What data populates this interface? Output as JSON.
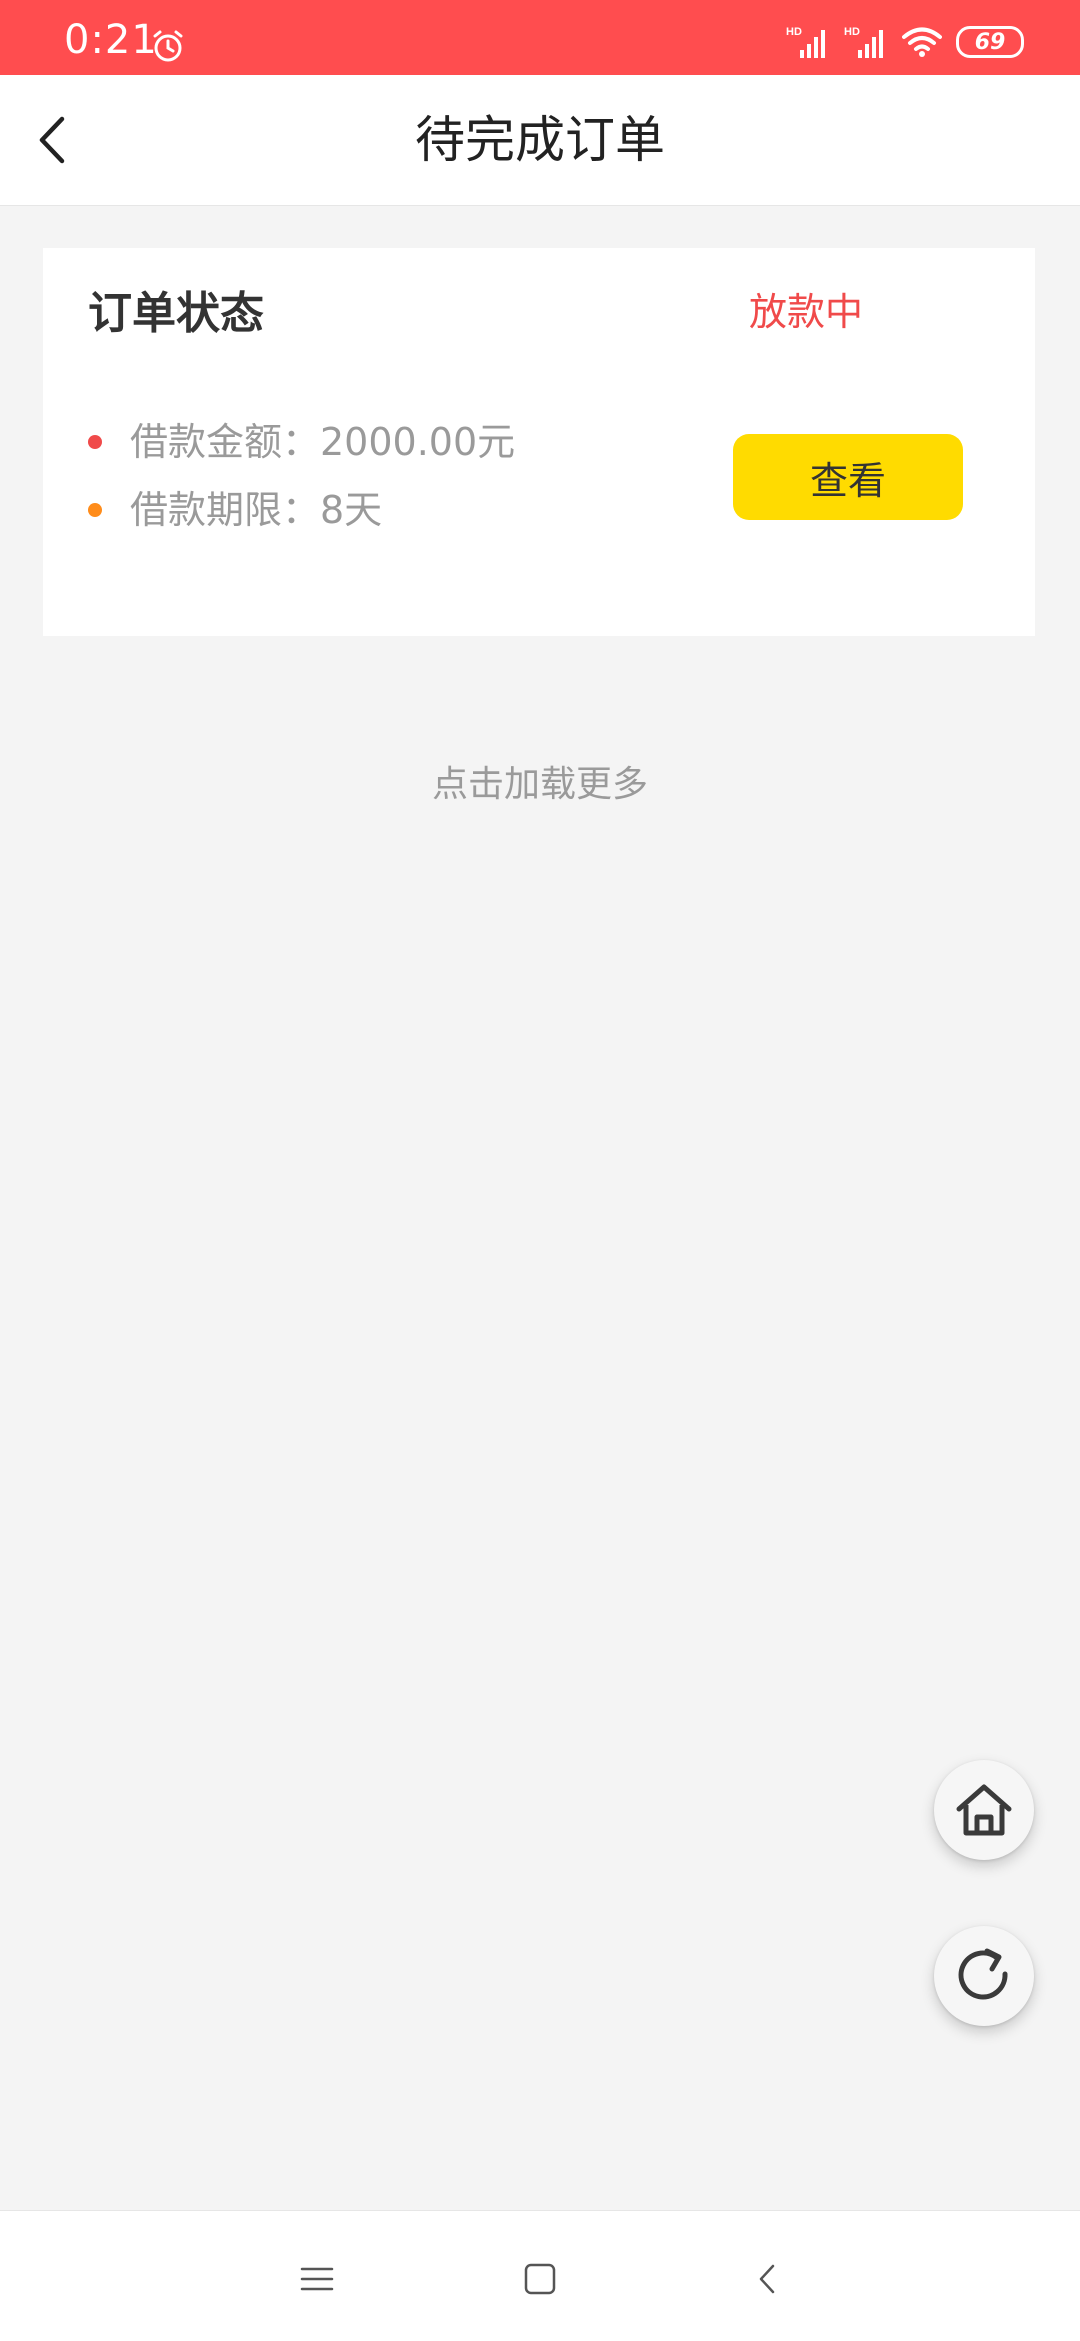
{
  "status_bar": {
    "time": "0:21",
    "battery": "69",
    "icons": [
      "alarm-icon",
      "hd-signal-icon",
      "hd-signal-icon",
      "wifi-icon",
      "battery-icon"
    ]
  },
  "header": {
    "title": "待完成订单",
    "back_icon": "chevron-left-icon"
  },
  "order_card": {
    "status_label": "订单状态",
    "status_value": "放款中",
    "rows": [
      {
        "text": "借款金额：2000.00元",
        "dot_color": "#f04a4a"
      },
      {
        "text": "借款期限：8天",
        "dot_color": "#ff8c1a"
      }
    ],
    "view_button": "查看"
  },
  "load_more": "点击加载更多",
  "floating_buttons": [
    "home-icon",
    "refresh-icon"
  ],
  "nav_bar": [
    "menu-icon",
    "home-square-icon",
    "back-icon"
  ],
  "colors": {
    "status_bar": "#ff4d4f",
    "accent_red": "#f04a4a",
    "button_yellow": "#ffdb00",
    "background": "#f4f4f4"
  }
}
